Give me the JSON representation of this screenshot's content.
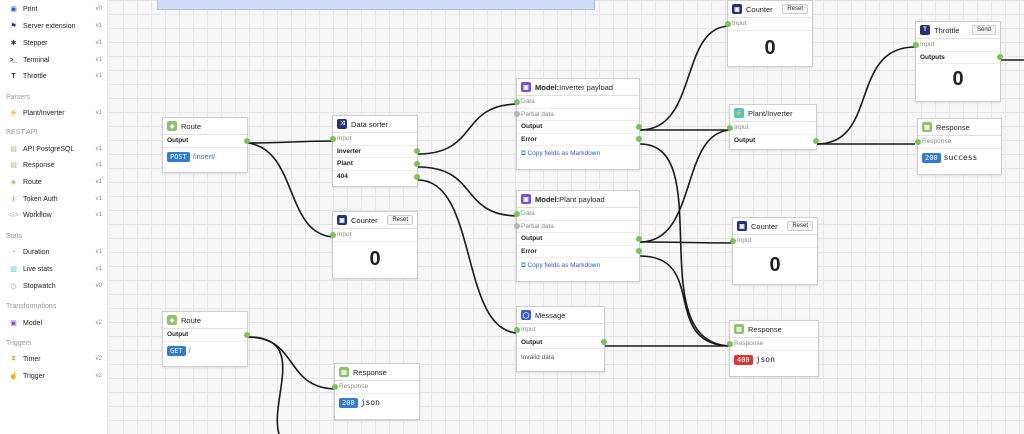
{
  "sidebar": {
    "items_top": [
      {
        "icon": "print-icon",
        "label": "Print",
        "version": "v0"
      },
      {
        "icon": "server-icon",
        "label": "Server extension",
        "version": "v1"
      },
      {
        "icon": "stepper-icon",
        "label": "Stepper",
        "version": "v1"
      },
      {
        "icon": "terminal-icon",
        "label": "Terminal",
        "version": "v1"
      },
      {
        "icon": "throttle-icon",
        "label": "Throttle",
        "version": "v1"
      }
    ],
    "parsers": {
      "heading": "Parsers",
      "items": [
        {
          "icon": "plant-inverter-icon",
          "label": "Plant/Inverter",
          "version": "v1"
        }
      ]
    },
    "rest_api": {
      "heading": "REST API",
      "items": [
        {
          "icon": "api-icon",
          "label": "API PostgreSQL",
          "version": "v1"
        },
        {
          "icon": "response-icon",
          "label": "Response",
          "version": "v1"
        },
        {
          "icon": "route-icon",
          "label": "Route",
          "version": "v1"
        },
        {
          "icon": "key-icon",
          "label": "Token Auth",
          "version": "v1"
        },
        {
          "icon": "workflow-icon",
          "label": "Workflow",
          "version": "v1"
        }
      ]
    },
    "stats": {
      "heading": "Stats",
      "items": [
        {
          "icon": "duration-icon",
          "label": "Duration",
          "version": "v1"
        },
        {
          "icon": "live-stats-icon",
          "label": "Live stats",
          "version": "v1"
        },
        {
          "icon": "stopwatch-icon",
          "label": "Stopwatch",
          "version": "v0"
        }
      ]
    },
    "transformations": {
      "heading": "Transformations",
      "items": [
        {
          "icon": "model-icon",
          "label": "Model",
          "version": "v2"
        }
      ]
    },
    "triggers": {
      "heading": "Triggers",
      "items": [
        {
          "icon": "timer-icon",
          "label": "Timer",
          "version": "v2"
        },
        {
          "icon": "trigger-icon",
          "label": "Trigger",
          "version": "v2"
        }
      ]
    }
  },
  "nodes": {
    "route1": {
      "title": "Route",
      "output": "Output",
      "method": "POST",
      "path": "/insert/"
    },
    "route2": {
      "title": "Route",
      "output": "Output",
      "method": "GET",
      "path": "/"
    },
    "sorter": {
      "title": "Data sorter",
      "input": "Input",
      "outputs": [
        "Inverter",
        "Plant",
        "404"
      ]
    },
    "counter1": {
      "title": "Counter",
      "reset": "Reset",
      "input": "Input",
      "value": "0"
    },
    "counter2": {
      "title": "Counter",
      "reset": "Reset",
      "input": "Input",
      "value": "0"
    },
    "counter3": {
      "title": "Counter",
      "reset": "Reset",
      "input": "Input",
      "value": "0"
    },
    "model_inverter": {
      "title_bold": "Model:",
      "title_rest": " Inverter payload",
      "data": "Data",
      "partial": "Partial data",
      "output": "Output",
      "error": "Error",
      "copy": "Copy fields as Markdown"
    },
    "model_plant": {
      "title_bold": "Model:",
      "title_rest": " Plant payload",
      "data": "Data",
      "partial": "Partial data",
      "output": "Output",
      "error": "Error",
      "copy": "Copy fields as Markdown"
    },
    "message": {
      "title": "Message",
      "input": "Input",
      "output": "Output",
      "text": "Invalid data"
    },
    "plant_inverter": {
      "title": "Plant/Inverter",
      "input": "Input",
      "output": "Output"
    },
    "throttle": {
      "title": "Throttle",
      "send": "Send",
      "input": "Input",
      "outputs": "Outputs",
      "value": "0"
    },
    "response_success": {
      "title": "Response",
      "response": "Response",
      "code": "200",
      "body": "success"
    },
    "response_400": {
      "title": "Response",
      "response": "Response",
      "code": "400",
      "body": "json"
    },
    "response_200": {
      "title": "Response",
      "response": "Response",
      "code": "200",
      "body": "json"
    }
  },
  "colors": {
    "accent_green": "#7cc35a",
    "method_blue": "#2f7bd8",
    "error_red": "#d43a3a"
  }
}
